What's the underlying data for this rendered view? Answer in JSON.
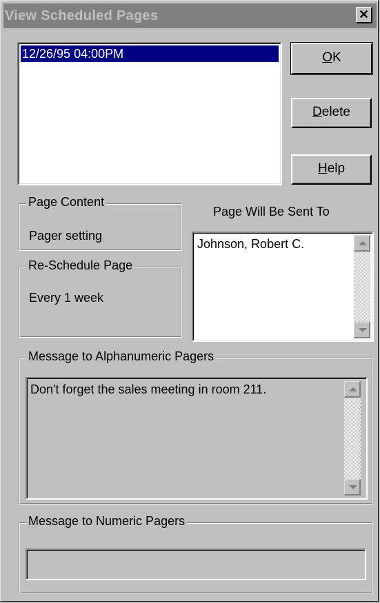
{
  "window": {
    "title": "View Scheduled Pages",
    "close_glyph": "✕"
  },
  "schedule_list": {
    "items": [
      "12/26/95 04:00PM"
    ],
    "selected_index": 0
  },
  "buttons": {
    "ok": {
      "accel": "O",
      "rest": "K"
    },
    "delete": {
      "accel": "D",
      "rest": "elete"
    },
    "help": {
      "accel": "H",
      "rest": "elp"
    }
  },
  "page_content": {
    "label": "Page Content",
    "value": "Pager setting"
  },
  "reschedule": {
    "label": "Re-Schedule Page",
    "value": "Every 1 week"
  },
  "sent_to": {
    "label": "Page Will Be Sent To",
    "recipients": [
      "Johnson, Robert C."
    ]
  },
  "alpha_message": {
    "label": "Message to Alphanumeric Pagers",
    "text": "Don't forget the sales meeting in room 211."
  },
  "numeric_message": {
    "label": "Message to Numeric Pagers",
    "text": ""
  },
  "icons": {
    "scroll_up": "arrow-up-icon",
    "scroll_down": "arrow-down-icon",
    "close": "close-icon"
  },
  "colors": {
    "selection": "#000080",
    "dialog_face": "#c0c0c0",
    "inactive_title": "#808080"
  }
}
